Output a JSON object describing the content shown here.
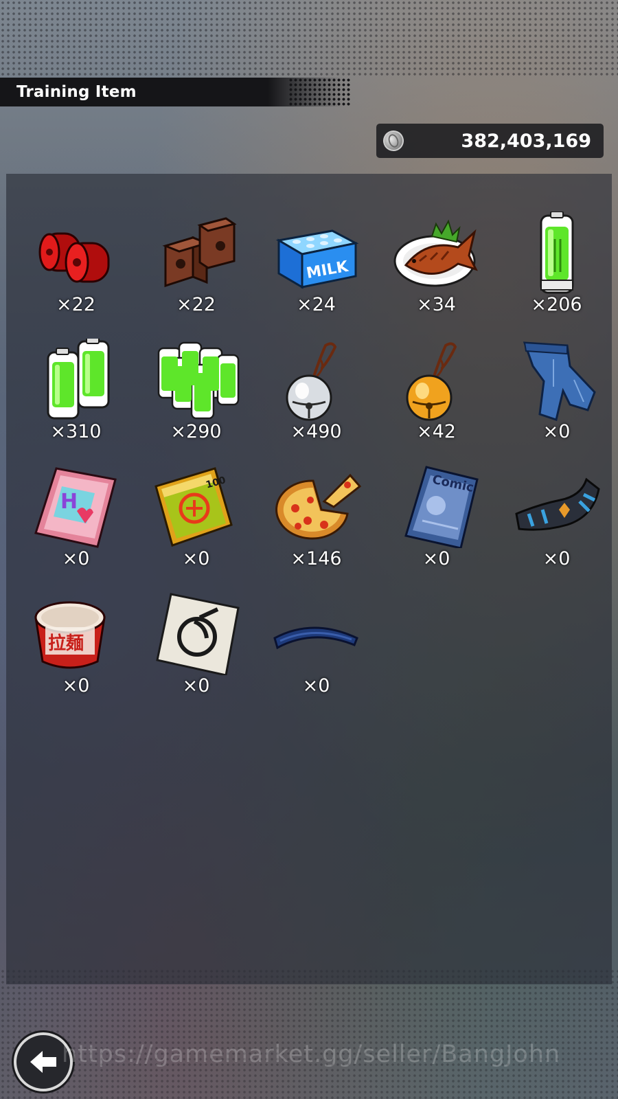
{
  "header": {
    "title": "Training Item"
  },
  "currency": {
    "icon": "coin-icon",
    "value": "382,403,169"
  },
  "items": [
    {
      "name": "red-weights",
      "icon": "red-weights-icon",
      "count": "×22"
    },
    {
      "name": "brick-blocks",
      "icon": "brick-blocks-icon",
      "count": "×22"
    },
    {
      "name": "milk-carton",
      "icon": "milk-carton-icon",
      "count": "×24"
    },
    {
      "name": "grilled-fish",
      "icon": "grilled-fish-icon",
      "count": "×34"
    },
    {
      "name": "energy-battery",
      "icon": "battery-icon",
      "count": "×206"
    },
    {
      "name": "energy-battery-pair",
      "icon": "battery-pair-icon",
      "count": "×310"
    },
    {
      "name": "energy-battery-pack",
      "icon": "battery-pack-icon",
      "count": "×290"
    },
    {
      "name": "silver-bell",
      "icon": "silver-bell-icon",
      "count": "×490"
    },
    {
      "name": "gold-bell",
      "icon": "gold-bell-icon",
      "count": "×42"
    },
    {
      "name": "jeans",
      "icon": "jeans-icon",
      "count": "×0"
    },
    {
      "name": "pink-magazine",
      "icon": "pink-magazine-icon",
      "count": "×0"
    },
    {
      "name": "green-book",
      "icon": "green-book-icon",
      "count": "×0"
    },
    {
      "name": "pizza",
      "icon": "pizza-icon",
      "count": "×146"
    },
    {
      "name": "comic-book",
      "icon": "comic-book-icon",
      "count": "×0"
    },
    {
      "name": "wristband",
      "icon": "wristband-icon",
      "count": "×0"
    },
    {
      "name": "ramen-cup",
      "icon": "ramen-cup-icon",
      "count": "×0"
    },
    {
      "name": "symbol-card",
      "icon": "symbol-card-icon",
      "count": "×0"
    },
    {
      "name": "blue-headband",
      "icon": "headband-icon",
      "count": "×0"
    }
  ],
  "back_button": {
    "icon": "back-arrow-icon"
  },
  "watermark": "https://gamemarket.gg/seller/BangJohn"
}
